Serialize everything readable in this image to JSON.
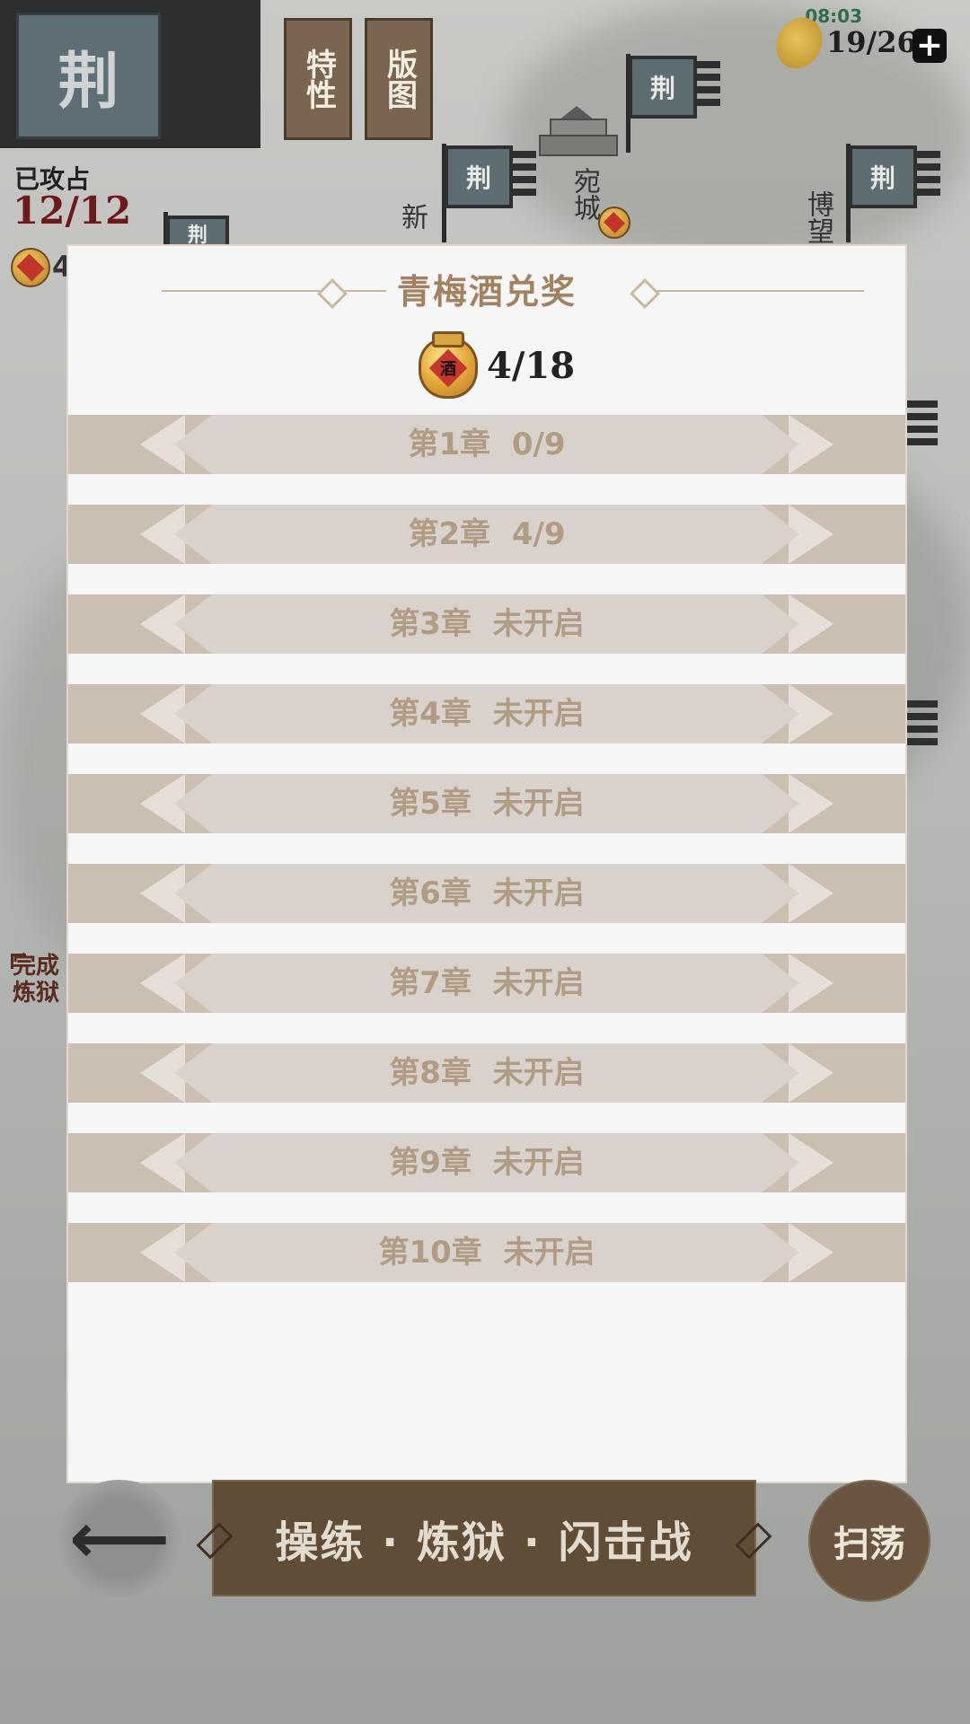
{
  "status_bar": {
    "time": "08:03",
    "food": "19/26",
    "plus": "+"
  },
  "header": {
    "faction_banner": "荆",
    "tabs": [
      "特性",
      "版图"
    ],
    "conquered_label": "已攻占",
    "conquered_count": "12/12",
    "wine_partial": "4"
  },
  "map": {
    "flag_label": "荆",
    "cities": [
      "新",
      "宛城",
      "博望"
    ],
    "side_note": "完成\n炼狱"
  },
  "modal": {
    "title": "青梅酒兑奖",
    "jar_seal": "酒",
    "wine_count": "4/18",
    "chapters": [
      {
        "name": "第1章",
        "status": "0/9"
      },
      {
        "name": "第2章",
        "status": "4/9"
      },
      {
        "name": "第3章",
        "status": "未开启"
      },
      {
        "name": "第4章",
        "status": "未开启"
      },
      {
        "name": "第5章",
        "status": "未开启"
      },
      {
        "name": "第6章",
        "status": "未开启"
      },
      {
        "name": "第7章",
        "status": "未开启"
      },
      {
        "name": "第8章",
        "status": "未开启"
      },
      {
        "name": "第9章",
        "status": "未开启"
      },
      {
        "name": "第10章",
        "status": "未开启"
      }
    ]
  },
  "bottom": {
    "back_icon": "arrow-left",
    "mode_label": "操练 · 炼狱 · 闪击战",
    "sweep_label": "扫荡"
  },
  "colors": {
    "modal_title": "#a18263",
    "chapter_text": "#b09c85",
    "conquered_count": "#6e1a1a",
    "mode_button": "#5f4d37"
  }
}
